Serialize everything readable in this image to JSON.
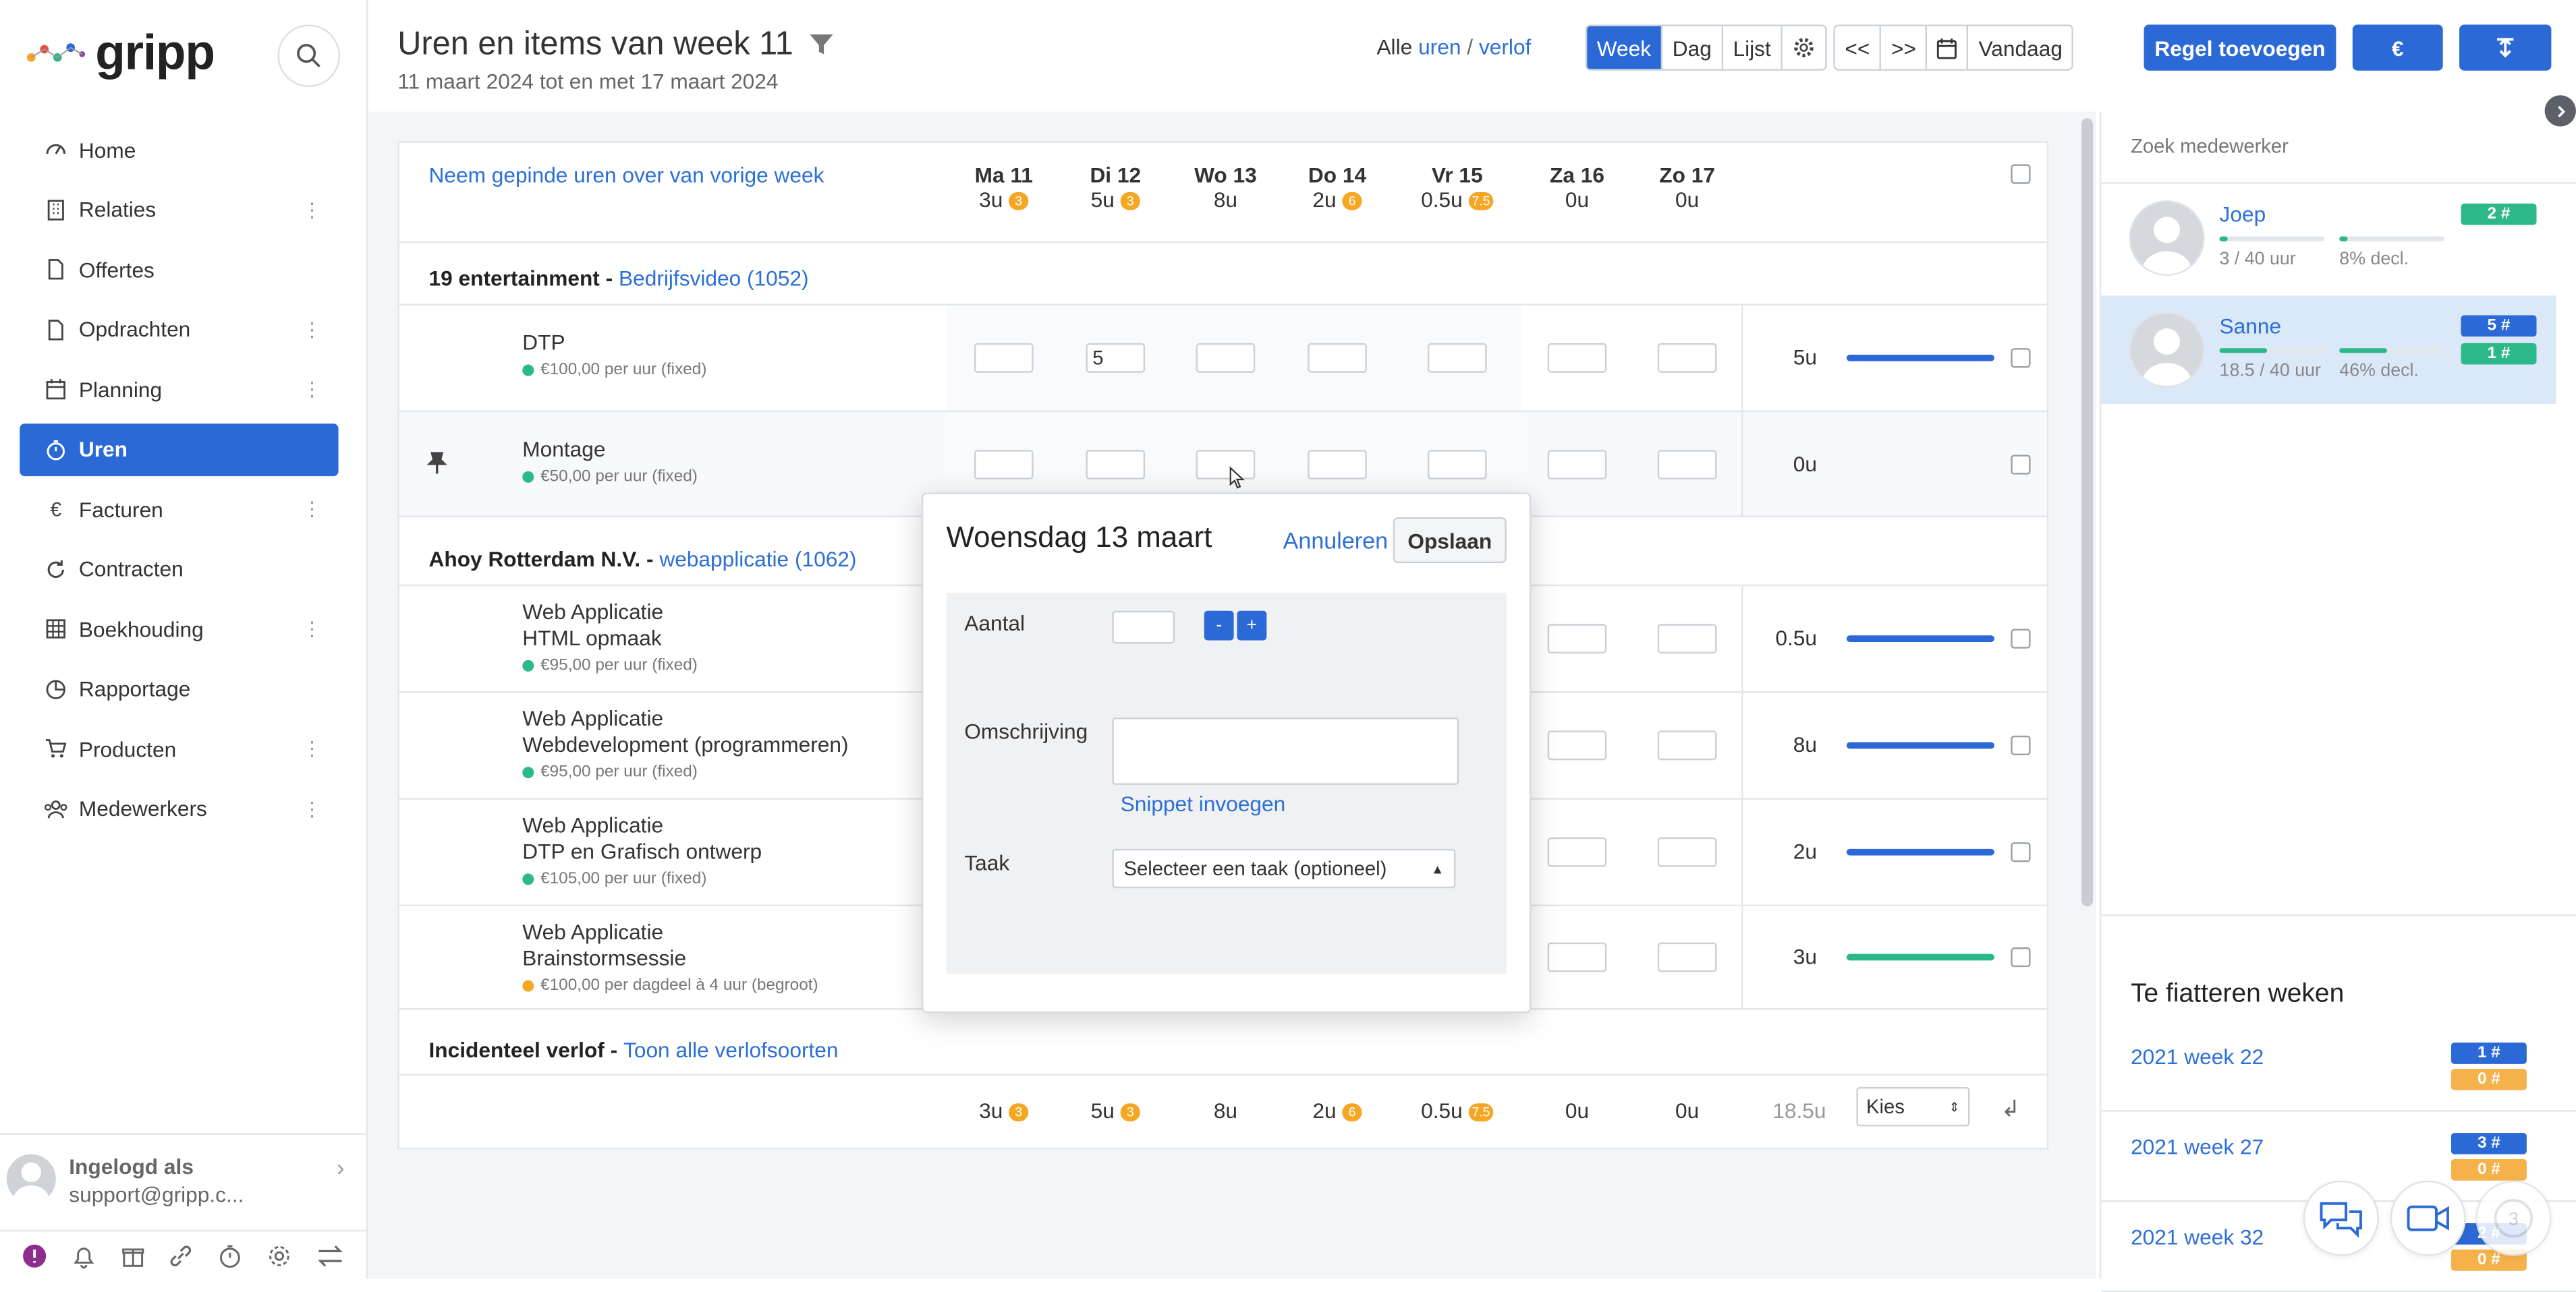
{
  "app": {
    "logo_text": "gripp"
  },
  "sidebar": {
    "items": [
      {
        "label": "Home",
        "icon": "speedometer-icon",
        "has_menu": false
      },
      {
        "label": "Relaties",
        "icon": "building-icon",
        "has_menu": true
      },
      {
        "label": "Offertes",
        "icon": "document-icon",
        "has_menu": false
      },
      {
        "label": "Opdrachten",
        "icon": "document-icon",
        "has_menu": true
      },
      {
        "label": "Planning",
        "icon": "calendar-icon",
        "has_menu": true
      },
      {
        "label": "Uren",
        "icon": "stopwatch-icon",
        "has_menu": false,
        "active": true
      },
      {
        "label": "Facturen",
        "icon": "euro-icon",
        "has_menu": true
      },
      {
        "label": "Contracten",
        "icon": "refresh-icon",
        "has_menu": false
      },
      {
        "label": "Boekhouding",
        "icon": "grid-icon",
        "has_menu": true
      },
      {
        "label": "Rapportage",
        "icon": "pie-chart-icon",
        "has_menu": false
      },
      {
        "label": "Producten",
        "icon": "cart-icon",
        "has_menu": true
      },
      {
        "label": "Medewerkers",
        "icon": "users-icon",
        "has_menu": true
      }
    ],
    "user": {
      "label": "Ingelogd als",
      "email": "support@gripp.c..."
    }
  },
  "header": {
    "title": "Uren en items van week 11",
    "subtitle": "11 maart 2024 tot en met 17 maart 2024",
    "filter_all": "Alle",
    "filter_hours": "uren",
    "filter_sep": "/",
    "filter_leave": "verlof",
    "views": [
      "Week",
      "Dag",
      "Lijst"
    ],
    "active_view": "Week",
    "nav_prev": "<<",
    "nav_next": ">>",
    "today": "Vandaag",
    "add_row": "Regel toevoegen",
    "euro": "€"
  },
  "grid": {
    "copy_link": "Neem gepinde uren over van vorige week",
    "days": [
      {
        "name": "Ma 11",
        "total": "3u",
        "badge": "3"
      },
      {
        "name": "Di 12",
        "total": "5u",
        "badge": "3"
      },
      {
        "name": "Wo 13",
        "total": "8u",
        "badge": ""
      },
      {
        "name": "Do 14",
        "total": "2u",
        "badge": "6"
      },
      {
        "name": "Vr 15",
        "total": "0.5u",
        "badge": "7.5"
      },
      {
        "name": "Za 16",
        "total": "0u",
        "badge": ""
      },
      {
        "name": "Zo 17",
        "total": "0u",
        "badge": ""
      }
    ],
    "groups": [
      {
        "client": "19 entertainment",
        "separator": " - ",
        "project": "Bedrijfsvideo (1052)",
        "rows": [
          {
            "line1": "DTP",
            "line2": "",
            "rate": "€100,00 per uur (fixed)",
            "rate_color": "#2db88a",
            "values": [
              "",
              "5",
              "",
              "",
              "",
              "",
              ""
            ],
            "total": "5u",
            "progress": 1.0,
            "bar_color": "#2b6ad6",
            "pinned": false
          },
          {
            "line1": "Montage",
            "line2": "",
            "rate": "€50,00 per uur (fixed)",
            "rate_color": "#2db88a",
            "values": [
              "",
              "",
              "",
              "",
              "",
              "",
              ""
            ],
            "total": "0u",
            "progress": 0,
            "bar_color": "#2b6ad6",
            "pinned": true
          }
        ]
      },
      {
        "client": "Ahoy Rotterdam N.V.",
        "separator": " - ",
        "project": "webapplicatie (1062)",
        "rows": [
          {
            "line1": "Web Applicatie",
            "line2": "HTML opmaak",
            "rate": "€95,00 per uur (fixed)",
            "rate_color": "#2db88a",
            "values": [
              "",
              "",
              "",
              "",
              "",
              "",
              ""
            ],
            "total": "0.5u",
            "progress": 1.0,
            "bar_color": "#2b6ad6",
            "pinned": false
          },
          {
            "line1": "Web Applicatie",
            "line2": "Webdevelopment (programmeren)",
            "rate": "€95,00 per uur (fixed)",
            "rate_color": "#2db88a",
            "values": [
              "",
              "",
              "",
              "",
              "",
              "",
              ""
            ],
            "total": "8u",
            "progress": 1.0,
            "bar_color": "#2b6ad6",
            "pinned": false
          },
          {
            "line1": "Web Applicatie",
            "line2": "DTP en Grafisch ontwerp",
            "rate": "€105,00 per uur (fixed)",
            "rate_color": "#2db88a",
            "values": [
              "",
              "",
              "",
              "",
              "",
              "",
              ""
            ],
            "total": "2u",
            "progress": 1.0,
            "bar_color": "#2b6ad6",
            "pinned": false
          },
          {
            "line1": "Web Applicatie",
            "line2": "Brainstormsessie",
            "rate": "€100,00 per dagdeel à 4 uur (begroot)",
            "rate_color": "#f5a623",
            "values": [
              "",
              "",
              "",
              "",
              "",
              "",
              ""
            ],
            "total": "3u",
            "progress": 1.0,
            "bar_color": "#2db88a",
            "pinned": false
          }
        ]
      }
    ],
    "leave": {
      "title": "Incidenteel verlof",
      "separator": " - ",
      "link": "Toon alle verlofsoorten"
    },
    "footer": {
      "totals": [
        {
          "v": "3u",
          "badge": "3"
        },
        {
          "v": "5u",
          "badge": "3"
        },
        {
          "v": "8u",
          "badge": ""
        },
        {
          "v": "2u",
          "badge": "6"
        },
        {
          "v": "0.5u",
          "badge": "7.5"
        },
        {
          "v": "0u",
          "badge": ""
        },
        {
          "v": "0u",
          "badge": ""
        }
      ],
      "week_total": "18.5u",
      "select_value": "Kies",
      "enter_icon": "↲"
    }
  },
  "modal": {
    "title": "Woensdag 13 maart",
    "cancel": "Annuleren",
    "save": "Opslaan",
    "amount_label": "Aantal",
    "amount_value": "",
    "minus": "-",
    "plus": "+",
    "description_label": "Omschrijving",
    "description_value": "",
    "snippet_link": "Snippet invoegen",
    "task_label": "Taak",
    "task_select": "Selecteer een taak (optioneel)"
  },
  "right_panel": {
    "search_placeholder": "Zoek medewerker",
    "employees": [
      {
        "name": "Joep",
        "hours": "3 / 40 uur",
        "hours_fraction": 0.075,
        "decl": "8% decl.",
        "decl_fraction": 0.08,
        "badges": [
          {
            "text": "2 #",
            "color": "green"
          }
        ],
        "selected": false
      },
      {
        "name": "Sanne",
        "hours": "18.5 / 40 uur",
        "hours_fraction": 0.46,
        "decl": "46% decl.",
        "decl_fraction": 0.46,
        "badges": [
          {
            "text": "5 #",
            "color": "blue"
          },
          {
            "text": "1 #",
            "color": "green"
          }
        ],
        "selected": true
      }
    ],
    "approve_title": "Te fiatteren weken",
    "weeks": [
      {
        "label": "2021 week 22",
        "b1": "1 #",
        "b2": "0 #"
      },
      {
        "label": "2021 week 27",
        "b1": "3 #",
        "b2": "0 #"
      },
      {
        "label": "2021 week 32",
        "b1": "2 #",
        "b2": "0 #"
      }
    ]
  },
  "colors": {
    "primary": "#2b6ad6",
    "success": "#2db88a",
    "warning": "#f5a623"
  }
}
